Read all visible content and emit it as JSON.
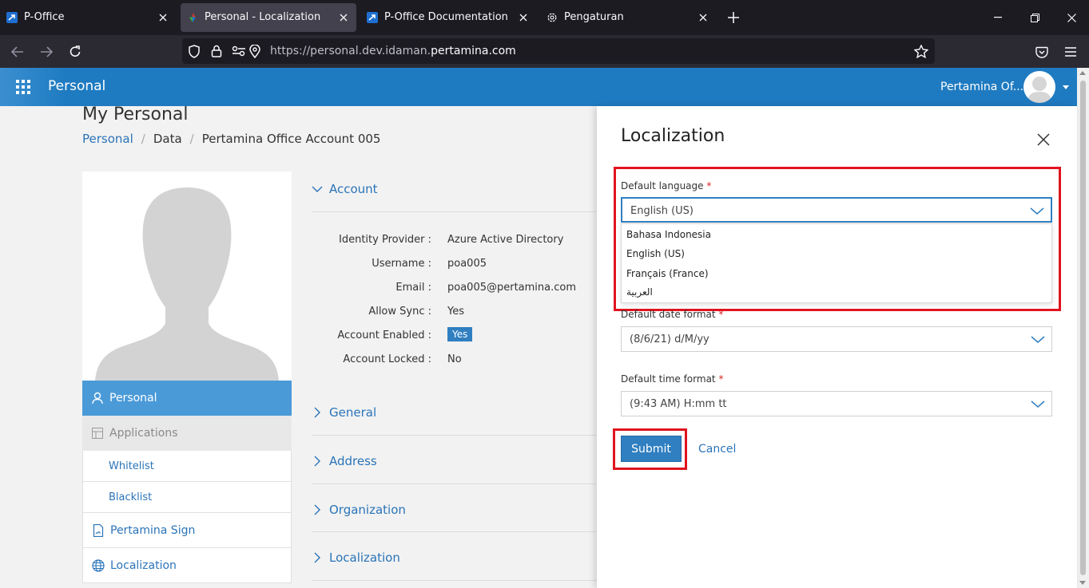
{
  "browser": {
    "tabs": [
      {
        "title": "P-Office",
        "active": false
      },
      {
        "title": "Personal - Localization",
        "active": true
      },
      {
        "title": "P-Office Documentation",
        "active": false
      },
      {
        "title": "Pengaturan",
        "active": false
      }
    ],
    "url_prefix": "https://personal.dev.idaman.",
    "url_domain": "pertamina.com"
  },
  "app": {
    "title": "Personal",
    "user_name": "Pertamina Of..."
  },
  "page": {
    "title": "My Personal",
    "breadcrumb": [
      "Personal",
      "Data",
      "Pertamina Office Account 005"
    ]
  },
  "sidemenu": {
    "personal": "Personal",
    "applications": "Applications",
    "whitelist": "Whitelist",
    "blacklist": "Blacklist",
    "pertamina_sign": "Pertamina Sign",
    "localization": "Localization"
  },
  "sections": {
    "account": "Account",
    "general": "General",
    "address": "Address",
    "organization": "Organization",
    "localization": "Localization"
  },
  "account": {
    "rows": [
      {
        "key": "Identity Provider :",
        "value": "Azure Active Directory"
      },
      {
        "key": "Username :",
        "value": "poa005"
      },
      {
        "key": "Email :",
        "value": "poa005@pertamina.com"
      },
      {
        "key": "Allow Sync :",
        "value": "Yes"
      },
      {
        "key": "Account Enabled :",
        "value": "Yes"
      },
      {
        "key": "Account Locked :",
        "value": "No"
      }
    ]
  },
  "drawer": {
    "title": "Localization",
    "language_label": "Default language",
    "language_value": "English (US)",
    "language_options": [
      "Bahasa Indonesia",
      "English (US)",
      "Français (France)",
      "العربية"
    ],
    "date_label": "Default date format",
    "date_value": "(8/6/21) d/M/yy",
    "time_label": "Default time format",
    "time_value": "(9:43 AM) H:mm tt",
    "required_mark": "*",
    "submit": "Submit",
    "cancel": "Cancel"
  },
  "colors": {
    "accent": "#2f7fc1",
    "header": "#1f7bc1",
    "highlight": "#e0141e"
  }
}
